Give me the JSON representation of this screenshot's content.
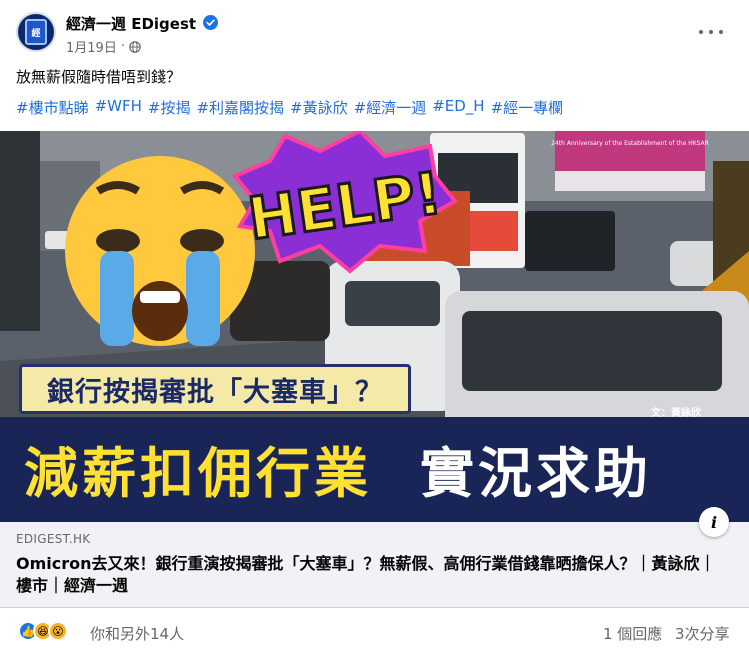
{
  "page": {
    "name": "經濟一週 EDigest",
    "date": "1月19日",
    "avatar_text": "經"
  },
  "post": {
    "text": "放無薪假隨時借唔到錢？",
    "hashtags": [
      "#樓市點睇",
      "#WFH",
      "#按揭",
      "#利嘉閣按揭",
      "#黃詠欣",
      "#經濟一週",
      "#ED_H",
      "#經一專欄"
    ]
  },
  "image": {
    "help_text": "HELP!",
    "subheadline": "銀行按揭審批「大塞車」？",
    "headline_part1": "減薪扣佣行業",
    "headline_part2": "實況求助",
    "byline": "文：黃詠欣",
    "billboard_text": "24th Anniversary of the Establishment of the HKSAR"
  },
  "link": {
    "domain": "EDIGEST.HK",
    "title": "Omicron去又來！銀行重演按揭審批「大塞車」？無薪假、高佣行業借錢靠晒擔保人？｜黃詠欣｜樓市｜經濟一週"
  },
  "footer": {
    "reaction_text": "你和另外14人",
    "comments": "1 個回應",
    "shares": "3次分享"
  },
  "colors": {
    "link_blue": "#216fdb",
    "verified_blue": "#1b74e4",
    "headline_yellow": "#ffe033",
    "band_navy": "#1a2557"
  },
  "icons": [
    "verified-badge-icon",
    "globe-icon",
    "more-options-icon",
    "info-icon",
    "like-reaction-icon",
    "haha-reaction-icon",
    "wow-reaction-icon"
  ]
}
